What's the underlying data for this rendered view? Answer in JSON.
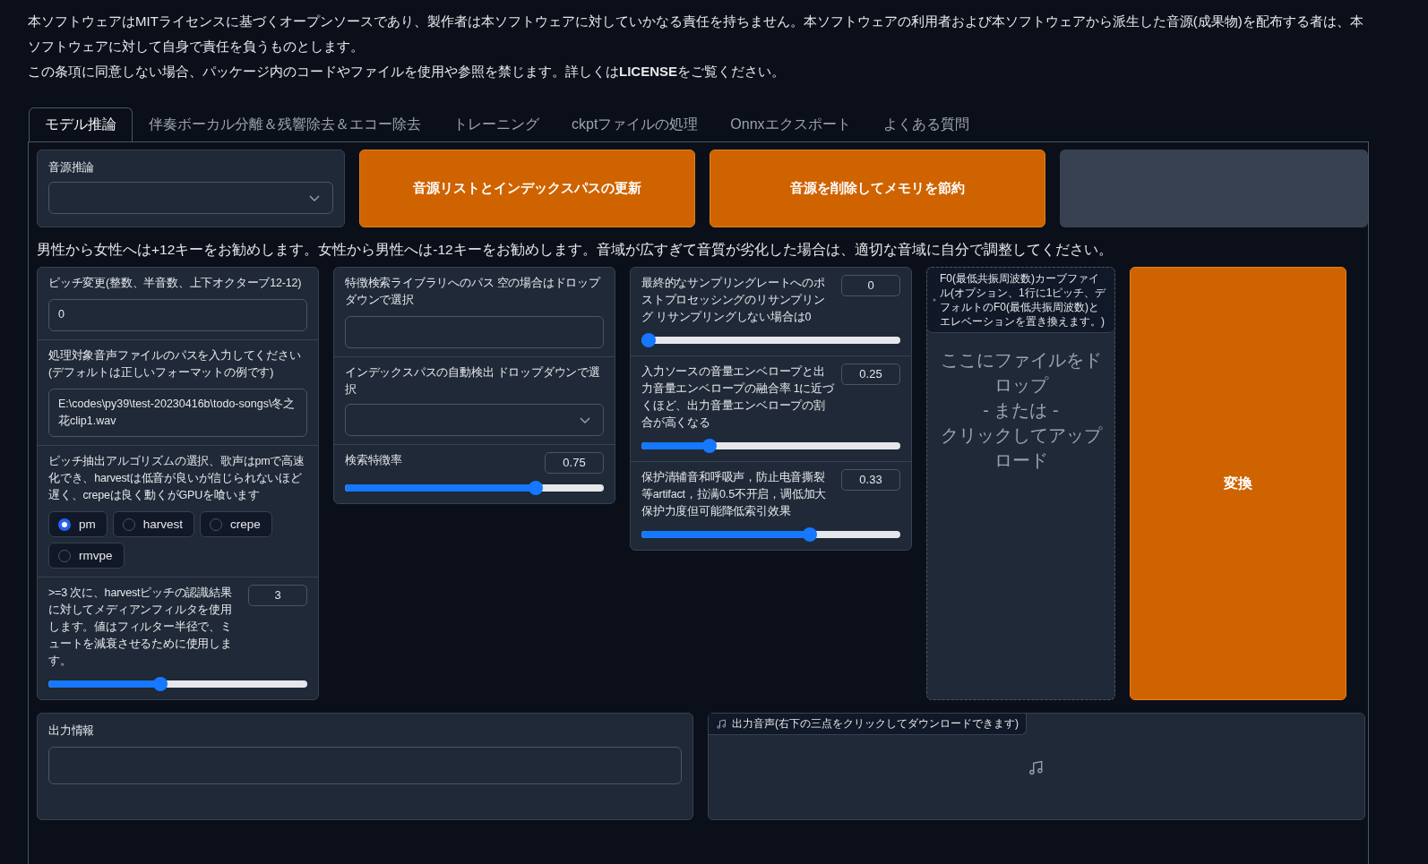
{
  "notice": [
    "本ソフトウェアはMITライセンスに基づくオープンソースであり、製作者は本ソフトウェアに対していかなる責任を持ちません。本ソフトウェアの利用者および本ソフトウェアから派生した音源(成果物)を配布する者は、本ソフトウェアに対して自身で責任を負うものとします。",
    "この条項に同意しない場合、パッケージ内のコードやファイルを使用や参照を禁じます。詳しくは**LICENSE**をご覧ください。"
  ],
  "tabs": [
    {
      "label": "モデル推論",
      "selected": true
    },
    {
      "label": "伴奏ボーカル分離＆残響除去＆エコー除去",
      "selected": false
    },
    {
      "label": "トレーニング",
      "selected": false
    },
    {
      "label": "ckptファイルの処理",
      "selected": false
    },
    {
      "label": "Onnxエクスポート",
      "selected": false
    },
    {
      "label": "よくある質問",
      "selected": false
    }
  ],
  "voice_select": {
    "label": "音源推論"
  },
  "buttons": [
    "音源リストとインデックスパスの更新",
    "音源を削除してメモリを節約"
  ],
  "hint": "男性から女性へは+12キーをお勧めします。女性から男性へは-12キーをお勧めします。音域が広すぎて音質が劣化した場合は、適切な音域に自分で調整してください。",
  "columns": [
    [
      {
        "kind": "textbox",
        "label": "ピッチ変更(整数、半音数、上下オクターブ12-12)",
        "value": "0"
      },
      {
        "kind": "textbox",
        "label": "処理対象音声ファイルのパスを入力してください(デフォルトは正しいフォーマットの例です)",
        "value": "E:\\codes\\py39\\test-20230416b\\todo-songs\\冬之花clip1.wav"
      },
      {
        "kind": "radio",
        "label": "ピッチ抽出アルゴリズムの選択、歌声はpmで高速化でき、harvestは低音が良いが信じられないほど遅く、crepeは良く動くがGPUを喰います",
        "options": [
          {
            "label": "pm",
            "selected": true
          },
          {
            "label": "harvest",
            "selected": false
          },
          {
            "label": "crepe",
            "selected": false
          },
          {
            "label": "rmvpe",
            "selected": false
          }
        ]
      },
      {
        "kind": "slider",
        "label": ">=3 次に、harvestピッチの認識結果に対してメディアンフィルタを使用します。値はフィルター半径で、ミュートを減衰させるために使用します。",
        "value": "3",
        "level": 0.43
      }
    ],
    [
      {
        "kind": "textbox",
        "label": "特徴検索ライブラリへのパス 空の場合はドロップダウンで選択"
      },
      {
        "kind": "dropdown",
        "label": "インデックスパスの自動検出 ドロップダウンで選択"
      },
      {
        "kind": "slider",
        "label": "検索特徴率",
        "value": "0.75",
        "level": 0.75
      }
    ],
    [
      {
        "kind": "slider",
        "label": "最終的なサンプリングレートへのポストプロセッシングのリサンプリング リサンプリングしない場合は0",
        "value": "0",
        "level": 0
      },
      {
        "kind": "slider",
        "label": "入力ソースの音量エンベロープと出力音量エンベロープの融合率 1に近づくほど、出力音量エンベロープの割合が高くなる",
        "value": "0.25",
        "level": 0.25
      },
      {
        "kind": "slider",
        "label": "保护清辅音和呼吸声，防止电音撕裂等artifact，拉满0.5不开启，调低加大保护力度但可能降低索引效果",
        "value": "0.33",
        "level": 0.66
      }
    ]
  ],
  "f0_file": {
    "label": "F0(最低共振周波数)カーブファイル(オプション、1行に1ピッチ、デフォルトのF0(最低共振周波数)とエレベーションを置き換えます。)",
    "drop_text": [
      "ここにファイルをドロップ",
      "- または -",
      "クリックしてアップロード"
    ]
  },
  "convert_button": "変換",
  "output_info": {
    "label": "出力情報"
  },
  "output_audio": {
    "label": "出力音声(右下の三点をクリックしてダウンロードできます)"
  }
}
